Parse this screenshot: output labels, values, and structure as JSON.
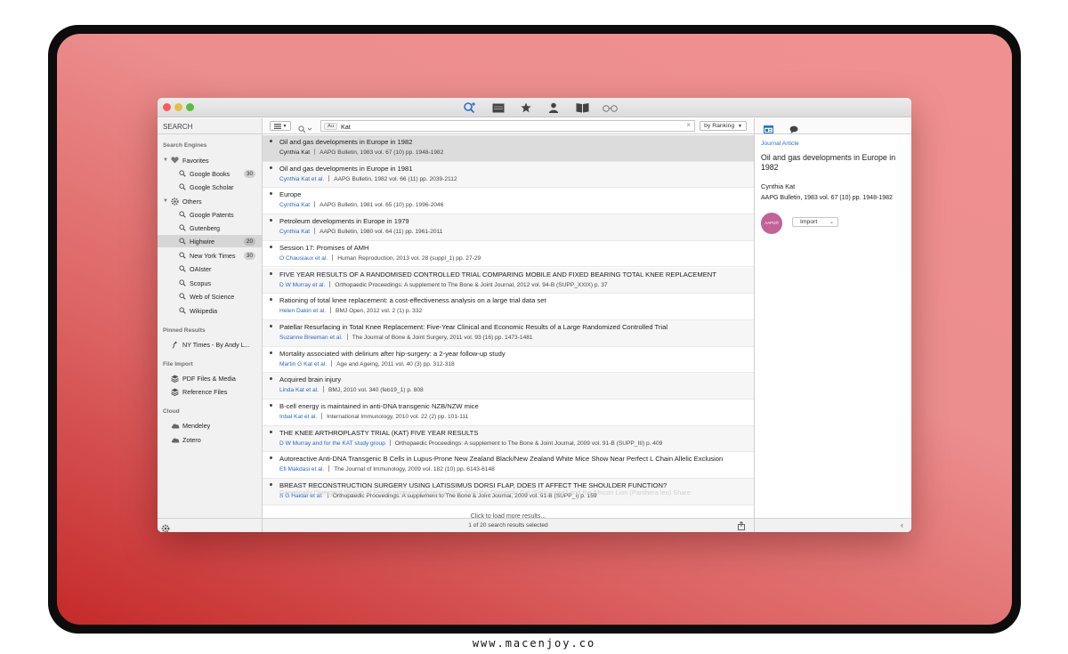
{
  "watermark": "www.macenjoy.co",
  "sidebar": {
    "search_label": "SEARCH",
    "sections": {
      "engines": "Search Engines",
      "pinned": "Pinned Results",
      "file_import": "File Import",
      "cloud": "Cloud"
    },
    "favorites": {
      "label": "Favorites",
      "items": [
        {
          "label": "Google Books",
          "count": "30"
        },
        {
          "label": "Google Scholar",
          "count": ""
        }
      ]
    },
    "others": {
      "label": "Others",
      "items": [
        {
          "label": "Google Patents",
          "count": ""
        },
        {
          "label": "Gutenberg",
          "count": ""
        },
        {
          "label": "Highwire",
          "count": "20",
          "selected": true
        },
        {
          "label": "New York Times",
          "count": "30"
        },
        {
          "label": "OAIster",
          "count": ""
        },
        {
          "label": "Scopus",
          "count": ""
        },
        {
          "label": "Web of Science",
          "count": ""
        },
        {
          "label": "Wikipedia",
          "count": ""
        }
      ]
    },
    "pinned_items": [
      {
        "label": "NY Times - By Andy L..."
      }
    ],
    "file_import_items": [
      {
        "label": "PDF Files & Media"
      },
      {
        "label": "Reference Files"
      }
    ],
    "cloud_items": [
      {
        "label": "Mendeley"
      },
      {
        "label": "Zotero"
      }
    ]
  },
  "toolbar": {
    "field_chip": "Au",
    "search_value": "Kat",
    "sort_label": "by Ranking"
  },
  "results": [
    {
      "title": "Oil and gas developments in Europe in 1982",
      "authors": "Cynthia Kat",
      "source": "AAPG Bulletin, 1983 vol. 67 (10) pp. 1948-1982",
      "selected": true
    },
    {
      "title": "Oil and gas developments in Europe in 1981",
      "authors": "Cynthia Kat et al.",
      "source": "AAPG Bulletin, 1982 vol. 66 (11) pp. 2039-2112"
    },
    {
      "title": "Europe",
      "authors": "Cynthia Kat",
      "source": "AAPG Bulletin, 1981 vol. 65 (10) pp. 1996-2046"
    },
    {
      "title": "Petroleum developments in Europe in 1979",
      "authors": "Cynthia Kat",
      "source": "AAPG Bulletin, 1980 vol. 64 (11) pp. 1961-2011"
    },
    {
      "title": "Session 17: Promises of AMH",
      "authors": "O Chausiaux et al.",
      "source": "Human Reproduction, 2013 vol. 28 (suppl_1) pp. 27-29"
    },
    {
      "title": "FIVE YEAR RESULTS OF A RANDOMISED CONTROLLED TRIAL COMPARING MOBILE AND FIXED BEARING TOTAL KNEE REPLACEMENT",
      "authors": "D W Murray et al.",
      "source": "Orthopaedic Proceedings: A supplement to The Bone & Joint Journal, 2012 vol. 94-B (SUPP_XXIX) p. 37"
    },
    {
      "title": "Rationing of total knee replacement: a cost-effectiveness analysis on a large trial data set",
      "authors": "Helen Dakin et al.",
      "source": "BMJ Open, 2012 vol. 2 (1) p. 332"
    },
    {
      "title": "Patellar Resurfacing in Total Knee Replacement: Five-Year Clinical and Economic Results of a Large Randomized Controlled Trial",
      "authors": "Suzanne Breeman et al.",
      "source": "The Journal of Bone & Joint Surgery, 2011 vol. 93 (16) pp. 1473-1481"
    },
    {
      "title": "Mortality associated with delirium after hip-surgery: a 2-year follow-up study",
      "authors": "Martin G Kat et al.",
      "source": "Age and Ageing, 2011 vol. 40 (3) pp. 312-318"
    },
    {
      "title": "Acquired brain injury",
      "authors": "Linda Kat et al.",
      "source": "BMJ, 2010 vol. 340 (feb19_1) p. 808"
    },
    {
      "title": "B-cell energy is maintained in anti-DNA transgenic NZB/NZW mice",
      "authors": "Inbal Kat et al.",
      "source": "International Immunology, 2010 vol. 22 (2) pp. 101-111"
    },
    {
      "title": "THE KNEE ARTHROPLASTY TRIAL (KAT) FIVE YEAR RESULTS",
      "authors": "D W Murray and for the KAT study group",
      "source": "Orthopaedic Proceedings: A supplement to The Bone & Joint Journal, 2009 vol. 91-B (SUPP_III) p. 409"
    },
    {
      "title": "Autoreactive Anti-DNA Transgenic B Cells in Lupus-Prone New Zealand Black/New Zealand White Mice Show Near Perfect L Chain Allelic Exclusion",
      "authors": "Efi Makdasi et al.",
      "source": "The Journal of Immunology, 2009 vol. 182 (10) pp. 6143-6148"
    },
    {
      "title": "BREAST RECONSTRUCTION SURGERY USING LATISSIMUS DORSI FLAP, DOES IT AFFECT THE SHOULDER FUNCTION?",
      "authors": "S G Haidar et al.",
      "source": "Orthopaedic Proceedings: A supplement to The Bone & Joint Journal, 2009 vol. 91-B (SUPP_I) p. 159"
    }
  ],
  "faded_row": "Genetically Divergent Strains of Feline Immunodeficiency Virus from the Domestic Cat (Felis catus) and the African Lion (Panthera leo) Share",
  "load_more": "Click to load more results...",
  "status_text": "1 of 20 search results selected",
  "detail": {
    "type": "Journal Article",
    "title": "Oil and gas developments in Europe in 1982",
    "author": "Cynthia Kat",
    "source": "AAPG Bulletin, 1983 vol. 67 (10) pp. 1948-1982",
    "logo_text": "AAPG®",
    "import_label": "Import"
  },
  "colors": {
    "accent": "#2a6fcf",
    "logo": "#c26296"
  }
}
